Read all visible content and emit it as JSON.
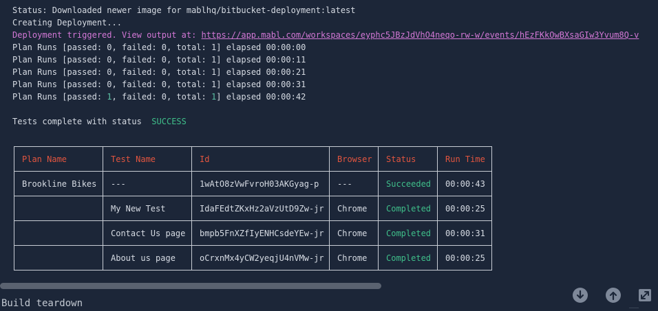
{
  "log": {
    "status_line": "Status: Downloaded newer image for mablhq/bitbucket-deployment:latest",
    "creating_line": "Creating Deployment...",
    "triggered_prefix": "Deployment triggered. View output at: ",
    "triggered_url": "https://app.mabl.com/workspaces/eyphc5JBzJdVhO4neqo-rw-w/events/hEzFKkOwBXsaGIw3Yvum8Q-v",
    "plan_runs": [
      {
        "prefix": "Plan Runs [passed: ",
        "passed": "0",
        "mid": ", failed: 0, total: ",
        "total": "1",
        "suffix": "] elapsed 00:00:00",
        "highlight": false
      },
      {
        "prefix": "Plan Runs [passed: ",
        "passed": "0",
        "mid": ", failed: 0, total: ",
        "total": "1",
        "suffix": "] elapsed 00:00:11",
        "highlight": false
      },
      {
        "prefix": "Plan Runs [passed: ",
        "passed": "0",
        "mid": ", failed: 0, total: ",
        "total": "1",
        "suffix": "] elapsed 00:00:21",
        "highlight": false
      },
      {
        "prefix": "Plan Runs [passed: ",
        "passed": "0",
        "mid": ", failed: 0, total: ",
        "total": "1",
        "suffix": "] elapsed 00:00:31",
        "highlight": false
      },
      {
        "prefix": "Plan Runs [passed: ",
        "passed": "1",
        "mid": ", failed: 0, total: ",
        "total": "1",
        "suffix": "] elapsed 00:00:42",
        "highlight": true
      }
    ],
    "complete_text": "Tests complete with status",
    "complete_status": "SUCCESS"
  },
  "results_table": {
    "headers": [
      "Plan Name",
      "Test Name",
      "Id",
      "Browser",
      "Status",
      "Run Time"
    ],
    "rows": [
      [
        "Brookline Bikes",
        "---",
        "1wAtO8zVwFvroH03AKGyag-p",
        "---",
        "Succeeded",
        "00:00:43"
      ],
      [
        "",
        "My New Test",
        "IdaFEdtZKxHz2aVzUtD9Zw-jr",
        "Chrome",
        "Completed",
        "00:00:25"
      ],
      [
        "",
        "Contact Us page",
        "bmpb5FnXZfIyENHCsdeYEw-jr",
        "Chrome",
        "Completed",
        "00:00:31"
      ],
      [
        "",
        "About us page",
        "oCrxnMx4yCW2yeqjU4nVMw-jr",
        "Chrome",
        "Completed",
        "00:00:25"
      ]
    ]
  },
  "footer": {
    "step_label": "Build teardown"
  },
  "controls": {
    "scroll_bottom_icon": "arrow-down-circle-icon",
    "scroll_top_icon": "arrow-up-circle-icon",
    "expand_icon": "expand-icon"
  },
  "colors": {
    "background": "#1c2638",
    "text": "#d6dbe3",
    "link_purple": "#d378d6",
    "success_green": "#3fbf8a",
    "header_red": "#e2553f"
  }
}
